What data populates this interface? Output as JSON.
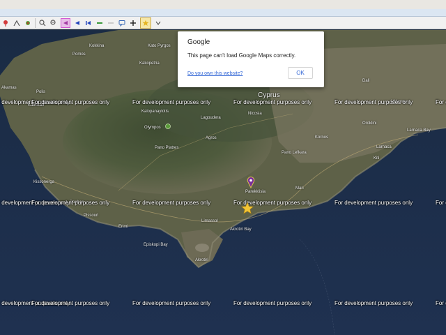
{
  "toolbar": {
    "icons": [
      "pin-icon",
      "search-icon",
      "arrow-left-icon",
      "arrow-right-icon",
      "line-icon",
      "comment-icon",
      "plus-icon",
      "star-icon"
    ]
  },
  "map": {
    "watermark": "For development purposes only",
    "region_label": "Cyprus",
    "places": {
      "kokkina": "Kokkina",
      "pomos": "Pomos",
      "kato_pyrgos": "Kato Pyrgos",
      "polis": "Polis",
      "kathikas": "Kathikas",
      "akamas": "Akamas",
      "paphos": "Paphos",
      "kissonerga": "Kissonerga",
      "kalopanayiotis": "Kalopanayiotis",
      "olympos": "Olympos",
      "agros": "Agros",
      "pano_platres": "Pano Platres",
      "lagoudera": "Lagoudera",
      "kakopetria": "Kakopetria",
      "pano_lefkara": "Pano Lefkara",
      "limassol": "Limassol",
      "akrotiri_bay": "Akrotiri Bay",
      "episkopi_bay": "Episkopi Bay",
      "larnaca_bay": "Larnaca Bay",
      "larnaca": "Larnaca",
      "oroklini": "Oroklini",
      "athienou": "Athienou",
      "kornos": "Kornos",
      "dali": "Dali",
      "nicosia_area": "Nicosia",
      "pissouri": "Pissouri",
      "erimi": "Erimi",
      "akrotiri": "Akrotiri",
      "parekklisia": "Parekklisia",
      "mari": "Mari",
      "kiti": "Kiti"
    }
  },
  "dialog": {
    "title": "Google",
    "message": "This page can't load Google Maps correctly.",
    "link": "Do you own this website?",
    "ok_label": "OK"
  }
}
